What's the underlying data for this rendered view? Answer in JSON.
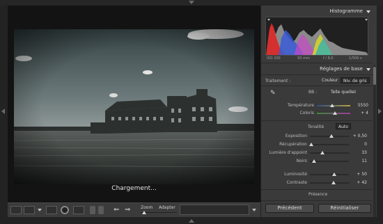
{
  "colors": {
    "accent": "#d7d7d7",
    "panel_bg": "#3a3a3a",
    "canvas_bg": "#131313"
  },
  "canvas": {
    "loading_text": "Chargement..."
  },
  "toolbar": {
    "zoom_label": "Zoom",
    "adapt_label": "Adapter",
    "icons": [
      "loupe-view-icon",
      "compare-view-icon",
      "crop-icon",
      "spot-removal-icon",
      "grid-icon",
      "flag-icon",
      "prev-arrow-icon",
      "next-arrow-icon"
    ]
  },
  "panel": {
    "histogram": {
      "title": "Histogramme",
      "iso": "ISO 200",
      "focal": "50 mm",
      "aperture": "f / 8,0",
      "shutter": "1/500 s"
    },
    "basic": {
      "title": "Réglages de base",
      "treatment_label": "Traitement :",
      "treatment_color": "Couleur",
      "treatment_bw": "Niv. de gris",
      "wb_label": "BB :",
      "wb_value": "Telle quelle",
      "sliders_wb": [
        {
          "label": "Température",
          "value": "5550",
          "pos": 0.46
        },
        {
          "label": "Coloris",
          "value": "+ 4",
          "pos": 0.55
        }
      ],
      "tone_label": "Tonalité",
      "auto_label": "Auto",
      "sliders_tone": [
        {
          "label": "Exposition",
          "value": "+ 0,50",
          "pos": 0.56
        },
        {
          "label": "Récupération",
          "value": "0",
          "pos": 0.04
        },
        {
          "label": "Lumière d'appoint",
          "value": "33",
          "pos": 0.33
        },
        {
          "label": "Noirs",
          "value": "11",
          "pos": 0.11
        }
      ],
      "sliders_light": [
        {
          "label": "Luminosité",
          "value": "+ 50",
          "pos": 0.62
        },
        {
          "label": "Contraste",
          "value": "+ 42",
          "pos": 0.6
        }
      ],
      "presence_label": "Présence"
    },
    "prev_button": "Précédent",
    "reset_button": "Réinitialiser"
  }
}
